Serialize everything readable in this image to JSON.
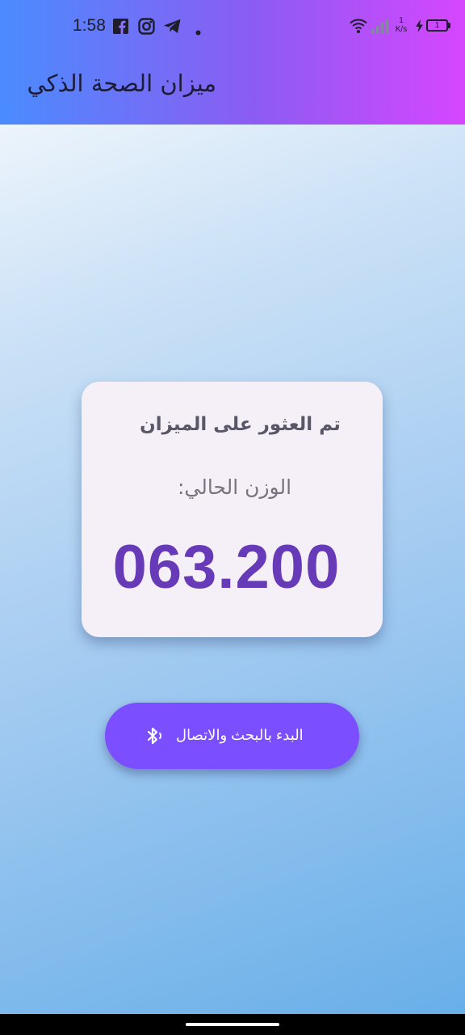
{
  "status_bar": {
    "time": "1:58",
    "net_speed_value": "1",
    "net_speed_unit": "K/s",
    "battery_level": "1",
    "left_icons": [
      "facebook-icon",
      "instagram-icon",
      "telegram-icon",
      "notification-dot-icon"
    ],
    "right_icons": [
      "wifi-icon",
      "signal-icon",
      "charging-icon",
      "battery-icon"
    ]
  },
  "app_bar": {
    "title": "ميزان الصحة الذكي",
    "gradient": [
      "#4a8cff",
      "#8c5cf2",
      "#d646ff"
    ]
  },
  "scale_card": {
    "status": "تم العثور على الميزان",
    "weight_label": "الوزن الحالي:",
    "weight_value": "063.200",
    "value_color": "#673ab7"
  },
  "connect_button": {
    "label": "البدء بالبحث والاتصال",
    "icon": "bluetooth-searching-icon",
    "color": "#7b4fff"
  }
}
